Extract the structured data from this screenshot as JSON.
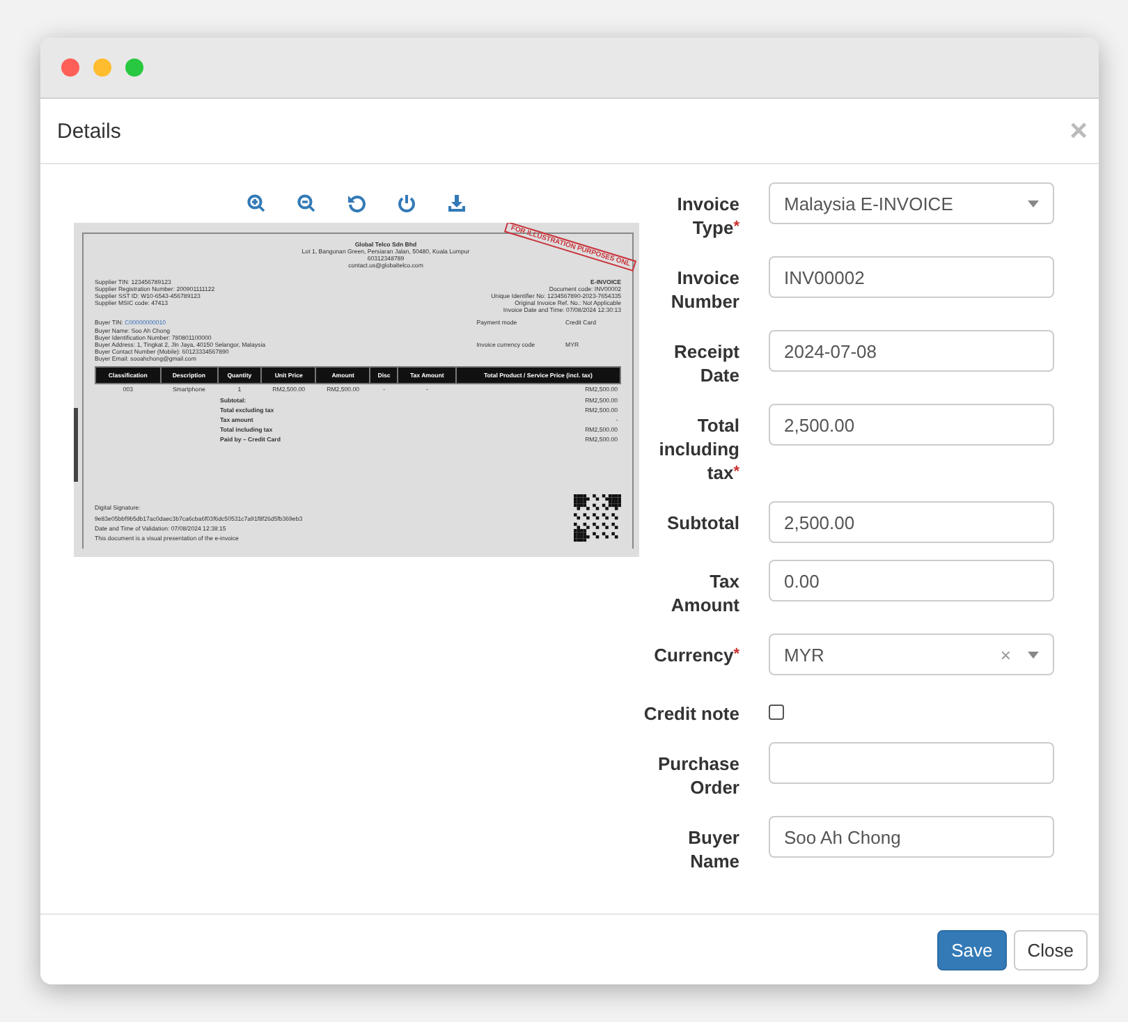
{
  "modal": {
    "title": "Details",
    "close_glyph": "×"
  },
  "document": {
    "stamp": "FOR ILLUSTRATION PURPOSES ONL",
    "company": {
      "name": "Global Telco Sdn Bhd",
      "lines": [
        "Lot 1, Bangunan Green, Persiaran Jalan, 50480, Kuala Lumpur",
        "60312348789",
        "contact.us@globaltelco.com"
      ]
    },
    "supplier_lines": [
      "Supplier TIN: 123456789123",
      "Supplier Registration Number: 200901111122",
      "Supplier SST ID: W10-6543-456789123",
      "Supplier MSIC code: 47413"
    ],
    "invoice_title": "E-INVOICE",
    "invoice_lines": [
      "Document code: INV00002",
      "Unique Identifier No: 1234567890-2023-7654335",
      "Original Invoice Ref. No.: Not Applicable",
      "Invoice Date and Time: 07/08/2024 12:30:13"
    ],
    "buyer_tin": {
      "label": "Buyer TIN:",
      "value": "C00000000010"
    },
    "buyer_lines": [
      "Buyer Name: Soo Ah Chong",
      "Buyer Identification Number: 780801100000",
      "Buyer Address: 1, Tingkat 2, Jln Jaya, 40150 Selangor, Malaysia",
      "Buyer Contact Number (Mobile): 60123334567890",
      "Buyer Email: sooahchong@gmail.com"
    ],
    "payment": [
      {
        "label": "Payment mode",
        "value": "Credit Card"
      },
      {
        "label": "Invoice currency code",
        "value": "MYR"
      }
    ],
    "table": {
      "columns": [
        "Classification",
        "Description",
        "Quantity",
        "Unit Price",
        "Amount",
        "Disc",
        "Tax Amount",
        "Total Product / Service Price (incl. tax)"
      ],
      "rows": [
        [
          "003",
          "Smartphone",
          "1",
          "RM2,500.00",
          "RM2,500.00",
          "-",
          "-",
          "RM2,500.00"
        ]
      ],
      "totals": [
        {
          "label": "Subtotal:",
          "value": "RM2,500.00"
        },
        {
          "label": "Total excluding tax",
          "value": "RM2,500.00"
        },
        {
          "label": "Tax amount",
          "value": "-"
        },
        {
          "label": "Total including tax",
          "value": "RM2,500.00"
        },
        {
          "label": "Paid by – Credit Card",
          "value": "RM2,500.00"
        }
      ]
    },
    "footer_lines": [
      "Digital Signature:",
      "9e83e05bbf9b5db17ac0daec3b7ca6cba6f03f6dc50531c7a91f8f26d5fb369eb3",
      "Date and Time of Validation: 07/08/2024  12:38:15",
      "This document is a visual presentation of the e-invoice"
    ]
  },
  "form": {
    "required_mark": "*",
    "fields": [
      {
        "label": "Invoice Type",
        "required": true,
        "kind": "select",
        "value": "Malaysia E-INVOICE"
      },
      {
        "label": "Invoice Number",
        "required": false,
        "kind": "text",
        "value": "INV00002"
      },
      {
        "label": "Receipt Date",
        "required": false,
        "kind": "text",
        "value": "2024-07-08"
      },
      {
        "label": "Total including tax",
        "required": true,
        "kind": "text",
        "value": "2,500.00"
      },
      {
        "label": "Subtotal",
        "required": false,
        "kind": "text",
        "value": "2,500.00"
      },
      {
        "label": "Tax Amount",
        "required": false,
        "kind": "text",
        "value": "0.00"
      },
      {
        "label": "Currency",
        "required": true,
        "kind": "select",
        "value": "MYR",
        "clear_glyph": "×"
      },
      {
        "label": "Credit note",
        "required": false,
        "kind": "checkbox",
        "checked": false
      },
      {
        "label": "Purchase Order",
        "required": false,
        "kind": "text"
      },
      {
        "label": "Buyer Name",
        "required": false,
        "kind": "text",
        "value": "Soo Ah Chong"
      }
    ]
  },
  "buttons": [
    {
      "label": "Save",
      "kind": "primary"
    },
    {
      "label": "Close",
      "kind": "default"
    }
  ]
}
